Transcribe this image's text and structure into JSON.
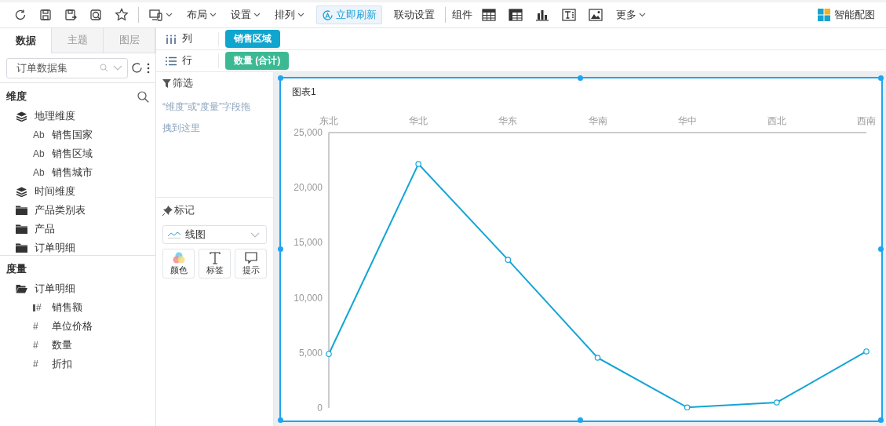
{
  "toolbar": {
    "menus": [
      {
        "label": "布局"
      },
      {
        "label": "设置"
      },
      {
        "label": "排列"
      }
    ],
    "refresh_button": "立即刷新",
    "linkage_button": "联动设置",
    "components_label": "组件",
    "more_menu": "更多",
    "smart_chart_button": "智能配图"
  },
  "sidebar": {
    "tabs": [
      {
        "label": "数据",
        "selected": true
      },
      {
        "label": "主题",
        "selected": false
      },
      {
        "label": "图层",
        "selected": false
      }
    ],
    "dataset": {
      "value": "订单数据集"
    },
    "dimensions": {
      "title": "维度",
      "items": [
        {
          "label": "地理维度",
          "kind": "layers",
          "children": [
            {
              "label": "销售国家",
              "kind": "field",
              "glyph": "Ab"
            },
            {
              "label": "销售区域",
              "kind": "field",
              "glyph": "Ab"
            },
            {
              "label": "销售城市",
              "kind": "field",
              "glyph": "Ab"
            }
          ]
        },
        {
          "label": "时间维度",
          "kind": "layers"
        },
        {
          "label": "产品类别表",
          "kind": "folder"
        },
        {
          "label": "产品",
          "kind": "folder"
        },
        {
          "label": "订单明细",
          "kind": "folder"
        }
      ]
    },
    "measures": {
      "title": "度量",
      "items": [
        {
          "label": "订单明细",
          "kind": "folder",
          "children": [
            {
              "label": "销售额",
              "kind": "calculated",
              "glyph": "#"
            },
            {
              "label": "单位价格",
              "kind": "field",
              "glyph": "#"
            },
            {
              "label": "数量",
              "kind": "field",
              "glyph": "#"
            },
            {
              "label": "折扣",
              "kind": "field",
              "glyph": "#"
            }
          ]
        }
      ]
    }
  },
  "shelves": [
    {
      "kind": "columns",
      "label": "列",
      "pill": "销售区域",
      "color": "#10a5cf"
    },
    {
      "kind": "rows",
      "label": "行",
      "pill": "数量 (合计)",
      "color": "#3cb993"
    }
  ],
  "filter": {
    "title": "筛选",
    "hint": "“维度”或“度量”字段拖拽到这里"
  },
  "marks": {
    "title": "标记",
    "chart_type": "线图",
    "buttons": [
      {
        "kind": "color",
        "label": "颜色"
      },
      {
        "kind": "label",
        "label": "标签"
      },
      {
        "kind": "tooltip",
        "label": "提示"
      }
    ]
  },
  "chart": {
    "title": "图表1",
    "chart_data": {
      "type": "line",
      "categories": [
        "东北",
        "华北",
        "华东",
        "华南",
        "华中",
        "西北",
        "西南"
      ],
      "series": [
        {
          "color": "#13a5d6",
          "marker": "circle",
          "values": [
            4900,
            22150,
            13450,
            4560,
            50,
            500,
            5130
          ]
        }
      ],
      "ylim": [
        0,
        25000
      ],
      "yticks": [
        {
          "value": 0,
          "label": "0"
        },
        {
          "value": 5000,
          "label": "5,000"
        },
        {
          "value": 10000,
          "label": "10,000"
        },
        {
          "value": 15000,
          "label": "15,000"
        },
        {
          "value": 20000,
          "label": "20,000"
        },
        {
          "value": 25000,
          "label": "25,000"
        }
      ]
    }
  }
}
